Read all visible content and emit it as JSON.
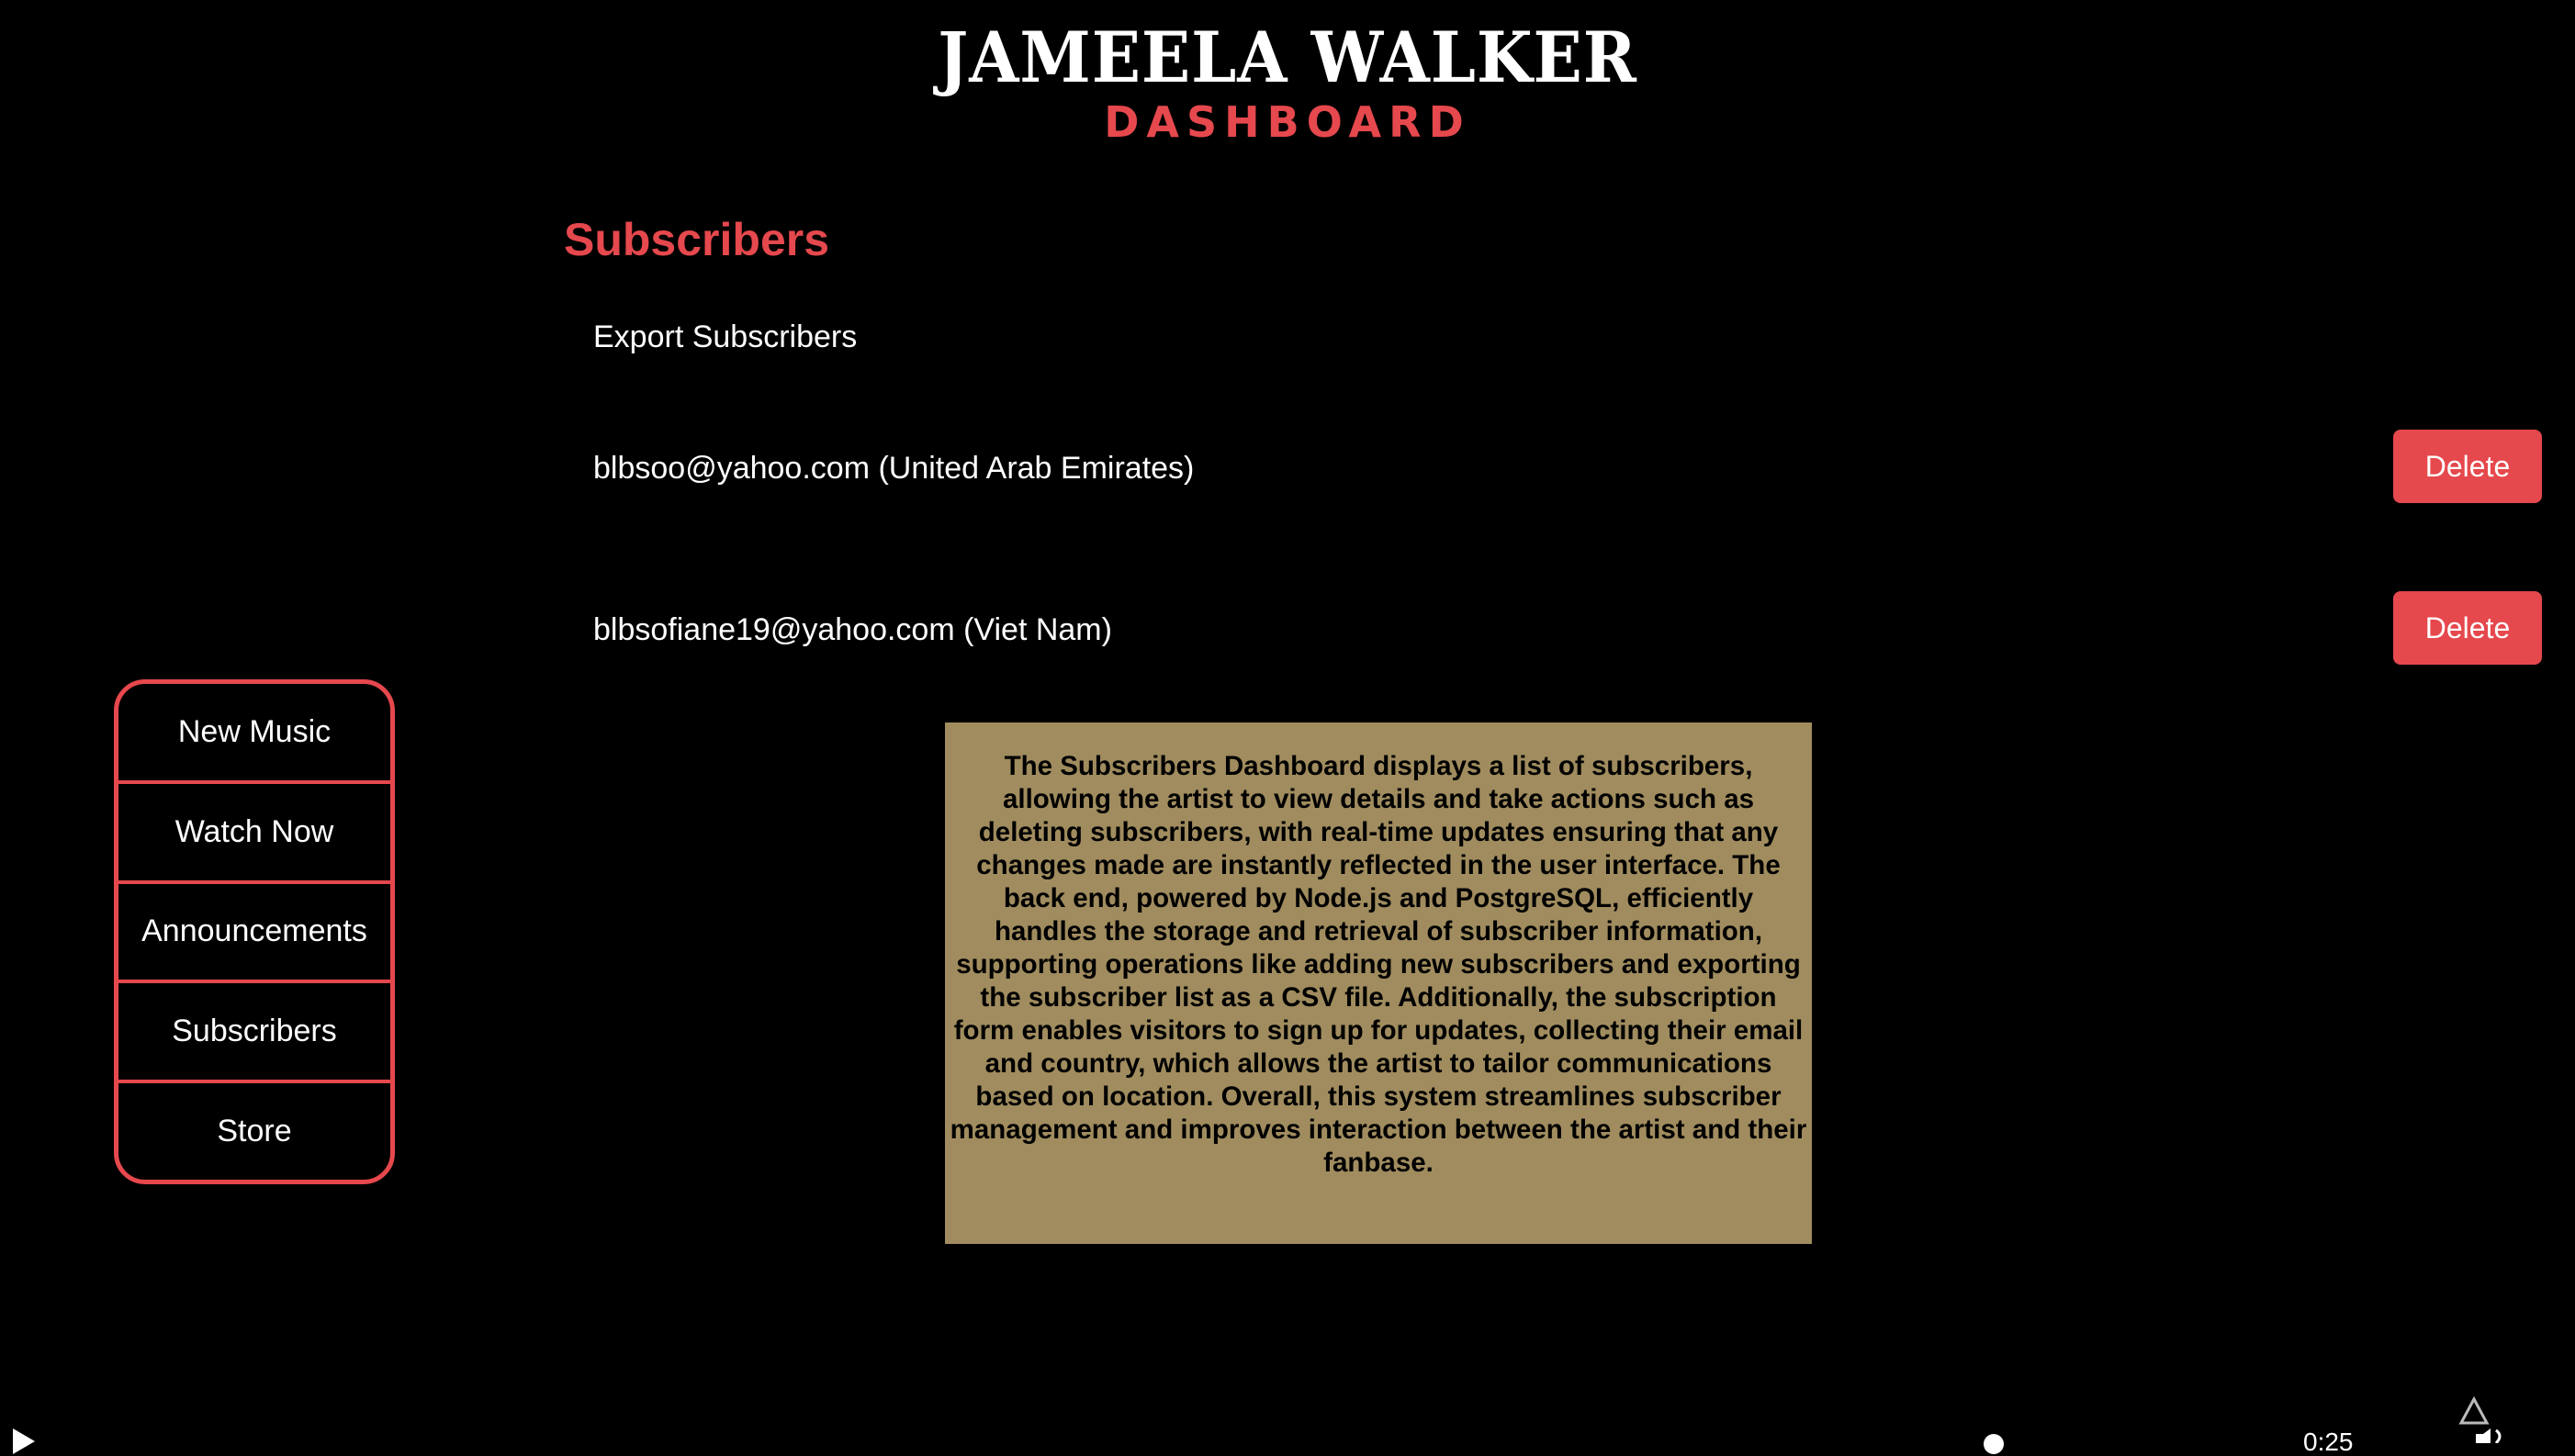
{
  "header": {
    "title": "JAMEELA WALKER",
    "subtitle": "DASHBOARD"
  },
  "section": {
    "heading": "Subscribers",
    "export_label": "Export Subscribers"
  },
  "subscribers": [
    {
      "label": "blbsoo@yahoo.com (United Arab Emirates)",
      "delete_label": "Delete"
    },
    {
      "label": "blbsofiane19@yahoo.com (Viet Nam)",
      "delete_label": "Delete"
    }
  ],
  "nav": {
    "items": [
      {
        "label": "New Music"
      },
      {
        "label": "Watch Now"
      },
      {
        "label": "Announcements"
      },
      {
        "label": "Subscribers"
      },
      {
        "label": "Store"
      }
    ]
  },
  "info": {
    "text": "The Subscribers Dashboard displays a list of subscribers, allowing the artist to view details and take actions such as deleting subscribers, with real-time updates ensuring that any changes made are instantly reflected in the user interface. The back end, powered by Node.js and PostgreSQL, efficiently handles the storage and retrieval of subscriber information, supporting operations like adding new subscribers and exporting the subscriber list as a CSV file. Additionally, the subscription form enables visitors to sign up for updates, collecting their email and country, which allows the artist to tailor communications based on location. Overall, this system streamlines subscriber management and improves interaction between the artist and their fanbase."
  },
  "player": {
    "time_fragment": "0:25",
    "icons": [
      "play-icon",
      "airplay-icon",
      "volume-icon"
    ]
  },
  "colors": {
    "accent": "#e5484d",
    "background": "#000000",
    "info_box": "#a08c5e"
  }
}
